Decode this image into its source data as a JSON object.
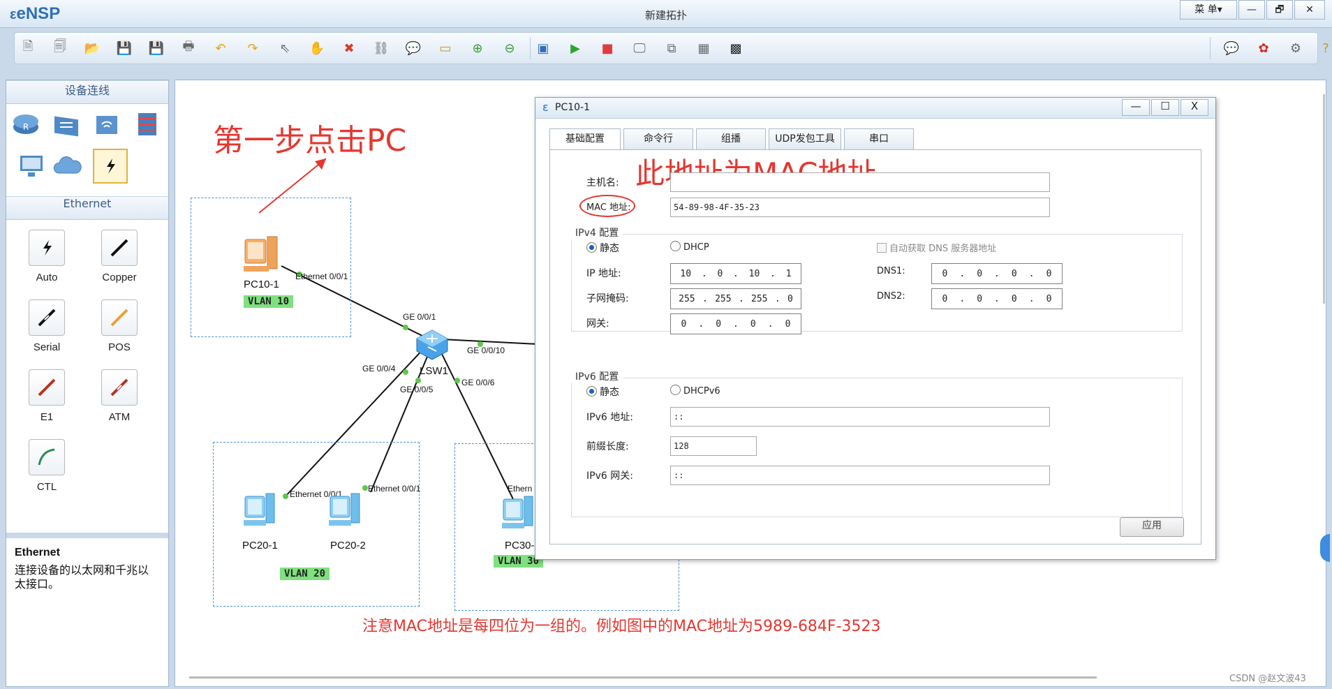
{
  "app": {
    "logo": "eNSP",
    "window_title": "新建拓扑",
    "menu_label": "菜 单▾",
    "minimize": "—",
    "restore": "🗗",
    "close": "✕"
  },
  "left_panel": {
    "section_devices": "设备连线",
    "section_ethernet": "Ethernet",
    "cables": [
      {
        "label": "Auto"
      },
      {
        "label": "Copper"
      },
      {
        "label": "Serial"
      },
      {
        "label": "POS"
      },
      {
        "label": "E1"
      },
      {
        "label": "ATM"
      },
      {
        "label": "CTL"
      }
    ],
    "desc_title": "Ethernet",
    "desc_text": "连接设备的以太网和千兆以太接口。"
  },
  "topology": {
    "nodes": {
      "pc10": "PC10-1",
      "lsw": "LSW1",
      "pc20_1": "PC20-1",
      "pc20_2": "PC20-2",
      "pc30": "PC30-"
    },
    "vlans": {
      "v10": "VLAN 10",
      "v20": "VLAN 20",
      "v30": "VLAN 30"
    },
    "ports": {
      "pc10_eth": "Ethernet 0/0/1",
      "ge1": "GE 0/0/1",
      "ge10": "GE 0/0/10",
      "ge4": "GE 0/0/4",
      "ge5": "GE 0/0/5",
      "ge6": "GE 0/0/6",
      "pc20_1_eth": "Ethernet 0/0/1",
      "pc20_2_eth": "Ethernet 0/0/1",
      "pc30_eth": "Ethern"
    },
    "annotations": {
      "step1": "第一步点击PC",
      "mac_note": "此地址为MAC地址",
      "bottom_note": "注意MAC地址是每四位为一组的。例如图中的MAC地址为5989-684F-3523"
    },
    "colors": {
      "annotation": "#e5362f",
      "vlan_bg": "#7fe07f",
      "dashed_box": "#4a8fd8"
    }
  },
  "dialog": {
    "title": "PC10-1",
    "minimize": "—",
    "maximize": "☐",
    "close": "X",
    "tabs": [
      "基础配置",
      "命令行",
      "组播",
      "UDP发包工具",
      "串口"
    ],
    "hostname_label": "主机名:",
    "hostname_value": "",
    "mac_label": "MAC 地址:",
    "mac_value": "54-89-98-4F-35-23",
    "ipv4": {
      "title": "IPv4 配置",
      "static": "静态",
      "dhcp": "DHCP",
      "auto_dns": "自动获取 DNS 服务器地址",
      "ip_label": "IP 地址:",
      "ip": [
        "10",
        "0",
        "10",
        "1"
      ],
      "mask_label": "子网掩码:",
      "mask": [
        "255",
        "255",
        "255",
        "0"
      ],
      "gw_label": "网关:",
      "gw": [
        "0",
        "0",
        "0",
        "0"
      ],
      "dns1_label": "DNS1:",
      "dns1": [
        "0",
        "0",
        "0",
        "0"
      ],
      "dns2_label": "DNS2:",
      "dns2": [
        "0",
        "0",
        "0",
        "0"
      ]
    },
    "ipv6": {
      "title": "IPv6 配置",
      "static": "静态",
      "dhcp": "DHCPv6",
      "addr_label": "IPv6 地址:",
      "addr": "::",
      "prefix_label": "前缀长度:",
      "prefix": "128",
      "gw_label": "IPv6 网关:",
      "gw": "::"
    },
    "apply": "应用"
  },
  "watermark": "CSDN @赵文波43"
}
